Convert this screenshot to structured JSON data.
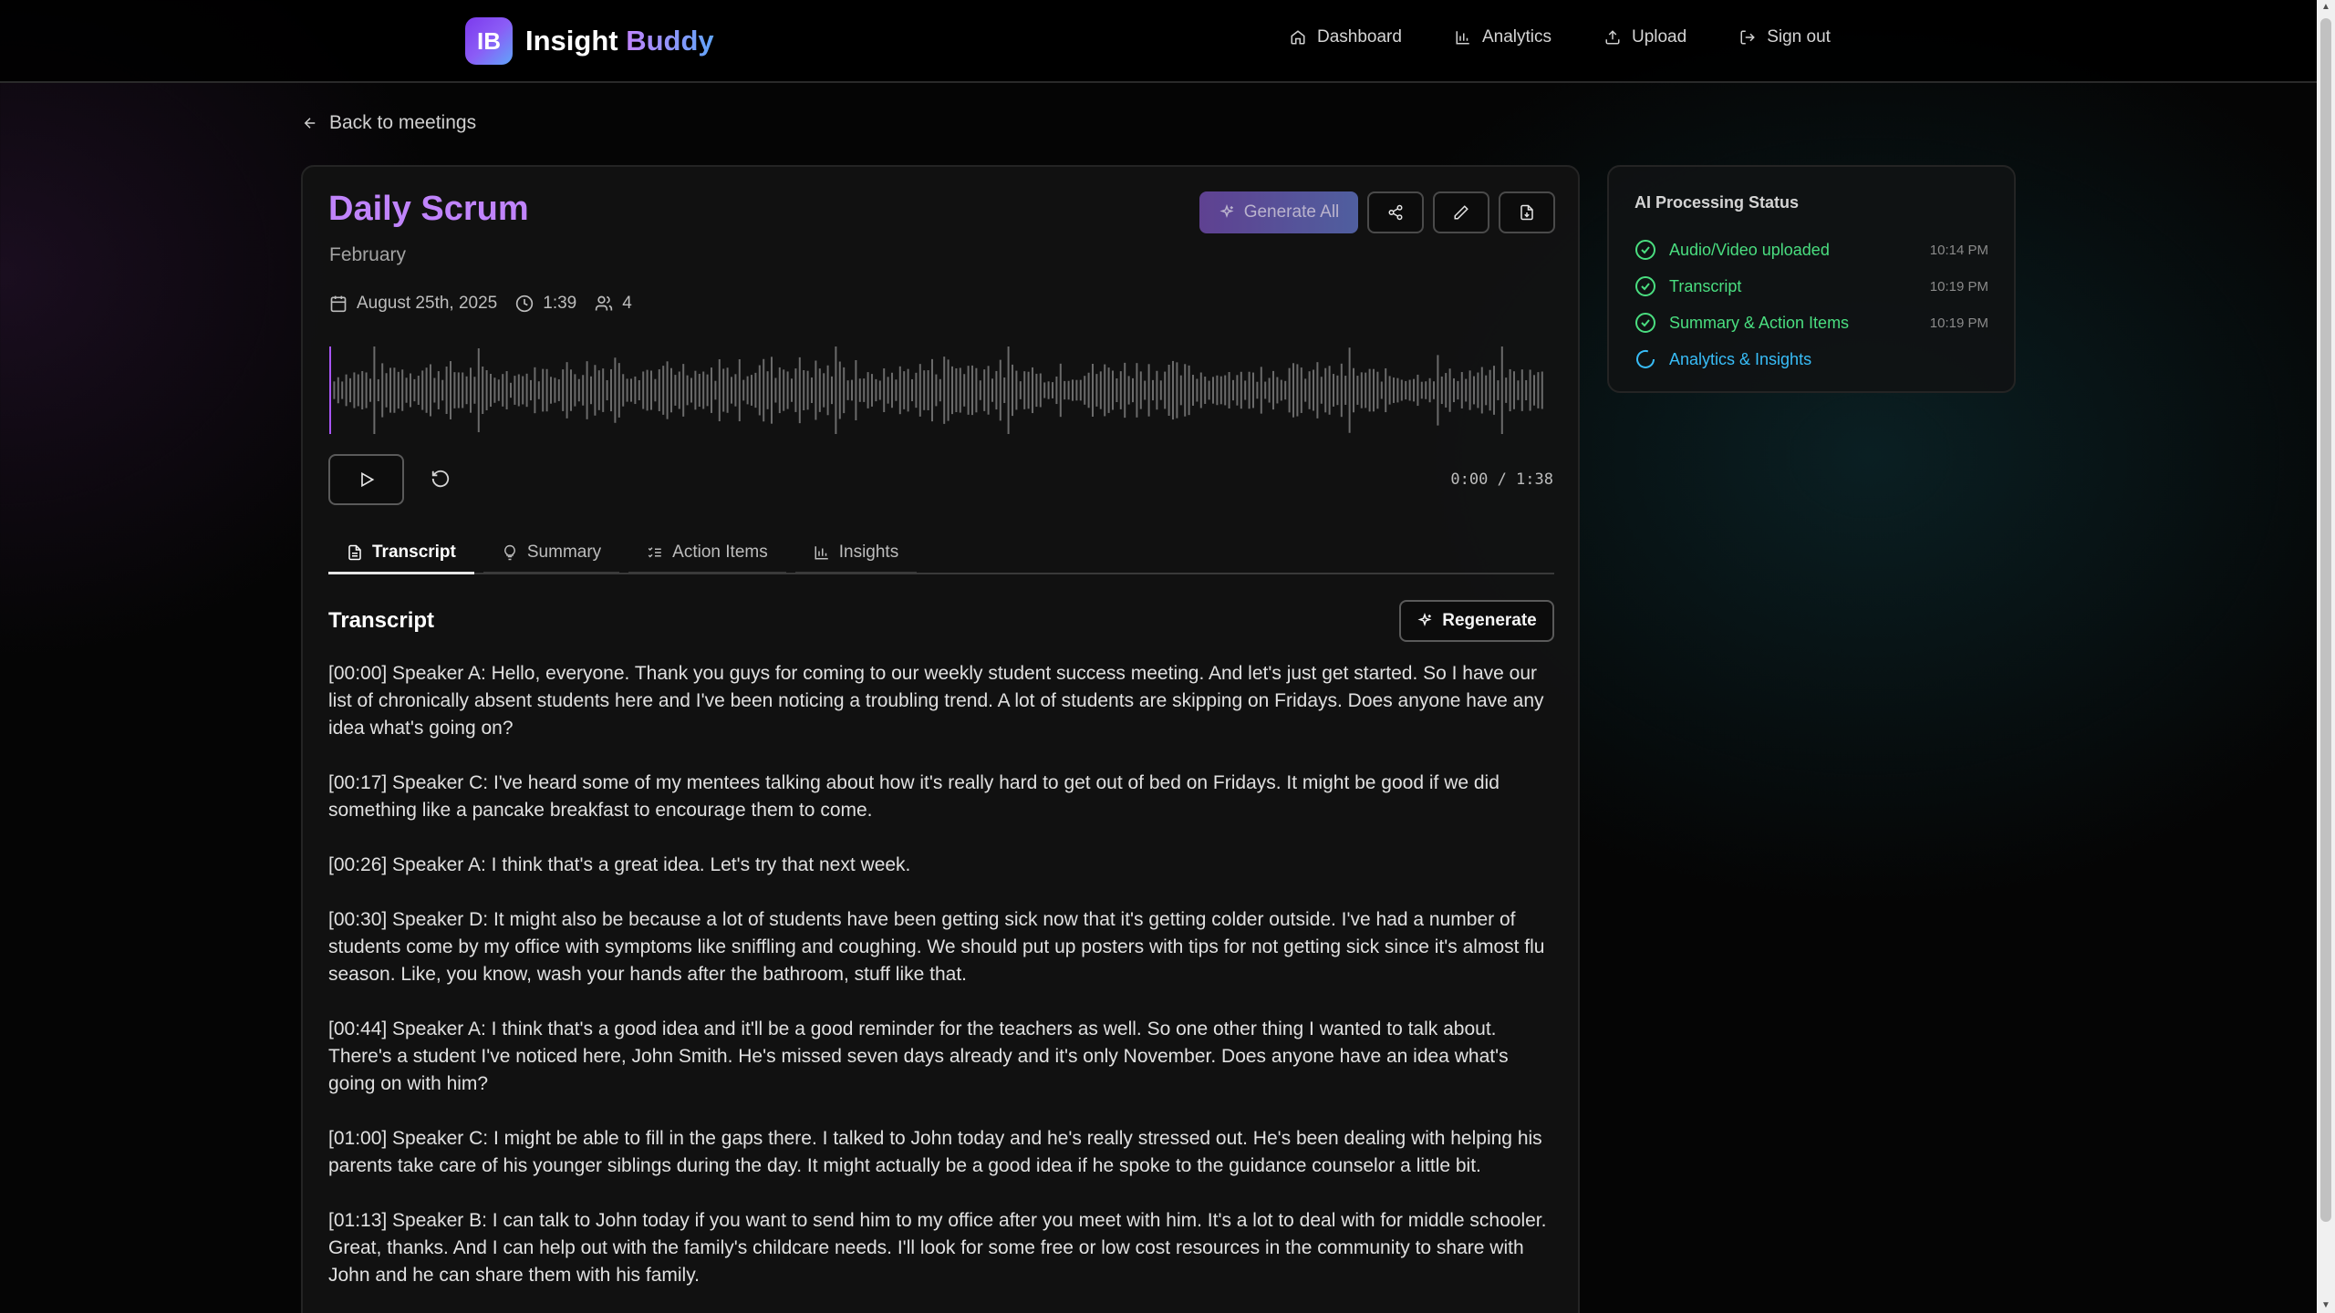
{
  "brand": {
    "logo": "IB",
    "name_first": "Insight",
    "name_second": "Buddy"
  },
  "nav": [
    {
      "label": "Dashboard",
      "icon": "home-icon"
    },
    {
      "label": "Analytics",
      "icon": "bar-chart-icon"
    },
    {
      "label": "Upload",
      "icon": "upload-icon"
    },
    {
      "label": "Sign out",
      "icon": "sign-out-icon"
    }
  ],
  "back_link": "Back to meetings",
  "meeting": {
    "title": "Daily Scrum",
    "subtitle": "February",
    "date": "August 25th, 2025",
    "duration": "1:39",
    "participants": "4"
  },
  "actions": {
    "generate_all": "Generate All"
  },
  "player": {
    "time": "0:00 / 1:38",
    "progress": 0
  },
  "tabs": [
    {
      "label": "Transcript",
      "active": true
    },
    {
      "label": "Summary",
      "active": false
    },
    {
      "label": "Action Items",
      "active": false
    },
    {
      "label": "Insights",
      "active": false
    }
  ],
  "transcript": {
    "title": "Transcript",
    "regenerate": "Regenerate",
    "entries": [
      "[00:00] Speaker A: Hello, everyone. Thank you guys for coming to our weekly student success meeting. And let's just get started. So I have our list of chronically absent students here and I've been noticing a troubling trend. A lot of students are skipping on Fridays. Does anyone have any idea what's going on?",
      "[00:17] Speaker C: I've heard some of my mentees talking about how it's really hard to get out of bed on Fridays. It might be good if we did something like a pancake breakfast to encourage them to come.",
      "[00:26] Speaker A: I think that's a great idea. Let's try that next week.",
      "[00:30] Speaker D: It might also be because a lot of students have been getting sick now that it's getting colder outside. I've had a number of students come by my office with symptoms like sniffling and coughing. We should put up posters with tips for not getting sick since it's almost flu season. Like, you know, wash your hands after the bathroom, stuff like that.",
      "[00:44] Speaker A: I think that's a good idea and it'll be a good reminder for the teachers as well. So one other thing I wanted to talk about. There's a student I've noticed here, John Smith. He's missed seven days already and it's only November. Does anyone have an idea what's going on with him?",
      "[01:00] Speaker C: I might be able to fill in the gaps there. I talked to John today and he's really stressed out. He's been dealing with helping his parents take care of his younger siblings during the day. It might actually be a good idea if he spoke to the guidance counselor a little bit.",
      "[01:13] Speaker B: I can talk to John today if you want to send him to my office after you meet with him. It's a lot to deal with for middle schooler. Great, thanks. And I can help out with the family's childcare needs. I'll look for some free or low cost resources in the community to share with John and he can share them with his family."
    ]
  },
  "status": {
    "title": "AI Processing Status",
    "items": [
      {
        "label": "Audio/Video uploaded",
        "time": "10:14 PM",
        "state": "done"
      },
      {
        "label": "Transcript",
        "time": "10:19 PM",
        "state": "done"
      },
      {
        "label": "Summary & Action Items",
        "time": "10:19 PM",
        "state": "done"
      },
      {
        "label": "Analytics & Insights",
        "time": "",
        "state": "pending"
      }
    ]
  },
  "colors": {
    "accent_purple": "#c084fc",
    "success": "#4ade80",
    "pending": "#38bdf8"
  }
}
